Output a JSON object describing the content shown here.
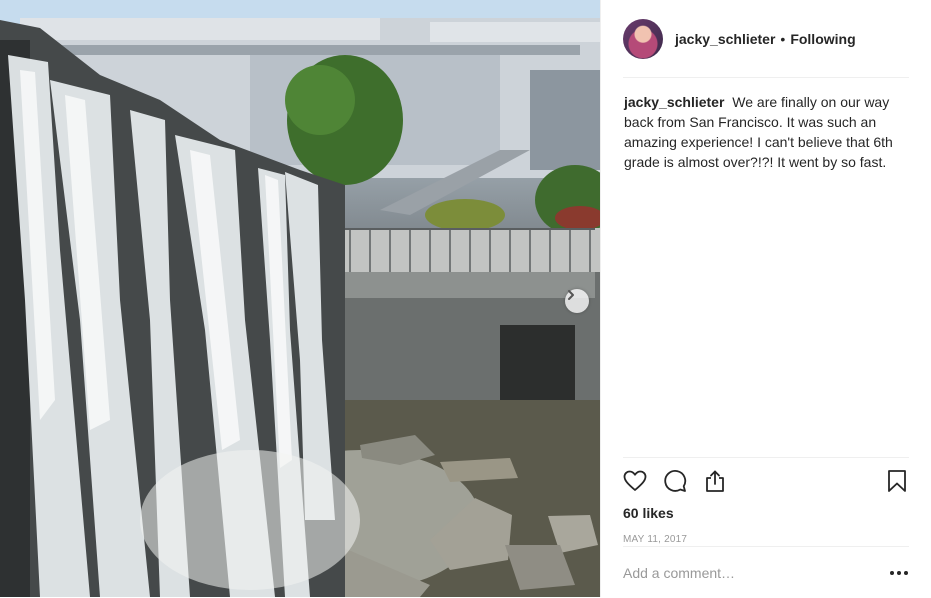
{
  "post": {
    "author": {
      "username": "jacky_schlieter",
      "separator": "•",
      "follow_state": "Following"
    },
    "caption": {
      "username": "jacky_schlieter",
      "text": "We are finally on our way back from San Francisco. It was such an amazing experience! I can't believe that 6th grade is almost over?!?! It went by so fast."
    },
    "likes": "60 likes",
    "date": "MAY 11, 2017",
    "comment": {
      "placeholder": "Add a comment…",
      "value": ""
    }
  },
  "icons": {
    "like": "heart-icon",
    "comment": "comment-bubble-icon",
    "share": "share-icon",
    "save": "bookmark-icon",
    "more": "more-options-icon",
    "next": "chevron-right-icon"
  },
  "colors": {
    "text": "#262626",
    "muted": "#999999",
    "divider": "#efefef"
  }
}
